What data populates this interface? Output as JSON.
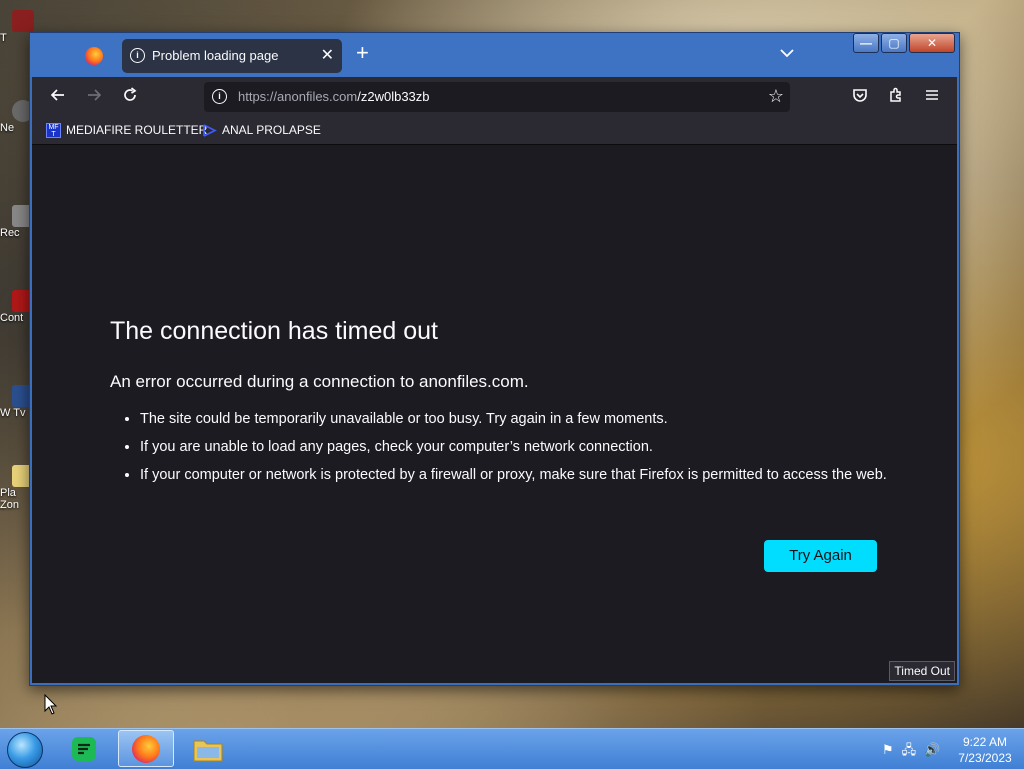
{
  "desktop": {
    "icons": [
      "T",
      "Ne",
      "Rec",
      "Cont",
      "W Tv",
      "Pla Zon"
    ]
  },
  "browser": {
    "tab": {
      "title": "Problem loading page"
    },
    "url": {
      "host": "https://anonfiles.com",
      "path": "/z2w0lb33zb"
    },
    "bookmarks": [
      {
        "label": "MEDIAFIRE ROULETTER",
        "fav_text": "MF T"
      },
      {
        "label": "ANAL PROLAPSE"
      }
    ],
    "error": {
      "title": "The connection has timed out",
      "subtitle": "An error occurred during a connection to anonfiles.com.",
      "items": [
        "The site could be temporarily unavailable or too busy. Try again in a few moments.",
        "If you are unable to load any pages, check your computer’s network connection.",
        "If your computer or network is protected by a firewall or proxy, make sure that Firefox is permitted to access the web."
      ],
      "button": "Try Again"
    },
    "status": "Timed Out"
  },
  "taskbar": {
    "time": "9:22 AM",
    "date": "7/23/2023"
  }
}
